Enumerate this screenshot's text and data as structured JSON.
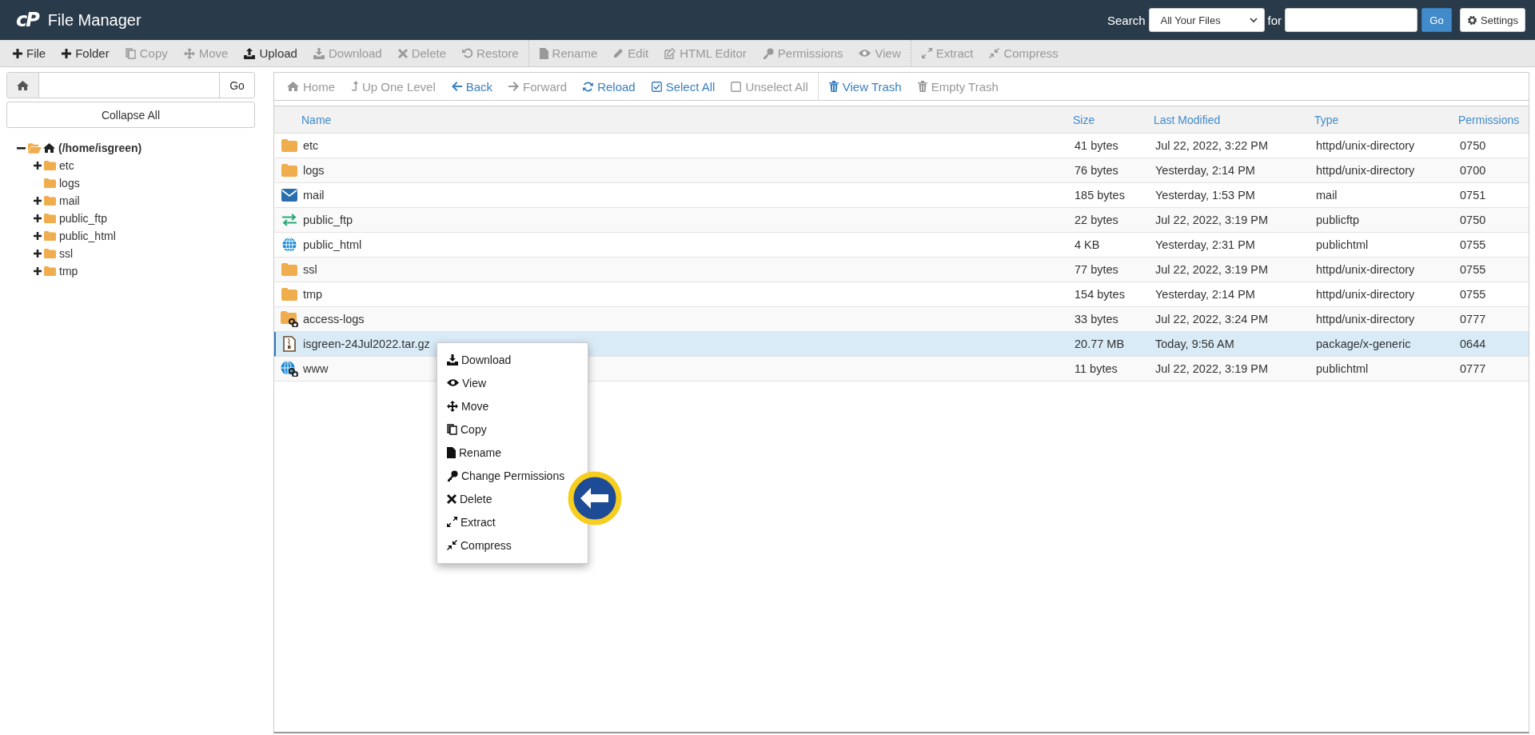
{
  "header": {
    "logo": "cP",
    "title": "File Manager",
    "search_label": "Search",
    "search_scope": "All Your Files",
    "for_label": "for",
    "go_button": "Go",
    "settings_button": "Settings"
  },
  "toolbar": [
    {
      "label": "File",
      "disabled": false
    },
    {
      "label": "Folder",
      "disabled": false
    },
    {
      "label": "Copy",
      "disabled": true
    },
    {
      "label": "Move",
      "disabled": true
    },
    {
      "label": "Upload",
      "disabled": false
    },
    {
      "label": "Download",
      "disabled": true
    },
    {
      "label": "Delete",
      "disabled": true
    },
    {
      "label": "Restore",
      "disabled": true
    },
    {
      "label": "Rename",
      "disabled": true
    },
    {
      "label": "Edit",
      "disabled": true
    },
    {
      "label": "HTML Editor",
      "disabled": true
    },
    {
      "label": "Permissions",
      "disabled": true
    },
    {
      "label": "View",
      "disabled": true
    },
    {
      "label": "Extract",
      "disabled": true
    },
    {
      "label": "Compress",
      "disabled": true
    }
  ],
  "sidebar": {
    "go_button": "Go",
    "collapse_button": "Collapse All",
    "tree": [
      {
        "label": "(/home/isgreen)",
        "expanded": true,
        "toggle": true,
        "children": [
          {
            "label": "etc",
            "expanded": false,
            "toggle": true
          },
          {
            "label": "logs",
            "expanded": false,
            "toggle": false
          },
          {
            "label": "mail",
            "expanded": false,
            "toggle": true
          },
          {
            "label": "public_ftp",
            "expanded": false,
            "toggle": true
          },
          {
            "label": "public_html",
            "expanded": false,
            "toggle": true
          },
          {
            "label": "ssl",
            "expanded": false,
            "toggle": true
          },
          {
            "label": "tmp",
            "expanded": false,
            "toggle": true
          }
        ]
      }
    ]
  },
  "nav": [
    {
      "label": "Home",
      "disabled": true
    },
    {
      "label": "Up One Level",
      "disabled": true
    },
    {
      "label": "Back",
      "disabled": false
    },
    {
      "label": "Forward",
      "disabled": true
    },
    {
      "label": "Reload",
      "disabled": false
    },
    {
      "label": "Select All",
      "disabled": false
    },
    {
      "label": "Unselect All",
      "disabled": true
    },
    {
      "label": "View Trash",
      "disabled": false
    },
    {
      "label": "Empty Trash",
      "disabled": true
    }
  ],
  "table": {
    "columns": [
      "Name",
      "Size",
      "Last Modified",
      "Type",
      "Permissions"
    ],
    "rows": [
      {
        "kind": "folder",
        "name": "etc",
        "size": "41 bytes",
        "modified": "Jul 22, 2022, 3:22 PM",
        "type": "httpd/unix-directory",
        "permissions": "0750",
        "selected": false
      },
      {
        "kind": "folder",
        "name": "logs",
        "size": "76 bytes",
        "modified": "Yesterday, 2:14 PM",
        "type": "httpd/unix-directory",
        "permissions": "0700",
        "selected": false
      },
      {
        "kind": "mail",
        "name": "mail",
        "size": "185 bytes",
        "modified": "Yesterday, 1:53 PM",
        "type": "mail",
        "permissions": "0751",
        "selected": false
      },
      {
        "kind": "ftp",
        "name": "public_ftp",
        "size": "22 bytes",
        "modified": "Jul 22, 2022, 3:19 PM",
        "type": "publicftp",
        "permissions": "0750",
        "selected": false
      },
      {
        "kind": "globe",
        "name": "public_html",
        "size": "4 KB",
        "modified": "Yesterday, 2:31 PM",
        "type": "publichtml",
        "permissions": "0755",
        "selected": false
      },
      {
        "kind": "folder",
        "name": "ssl",
        "size": "77 bytes",
        "modified": "Jul 22, 2022, 3:19 PM",
        "type": "httpd/unix-directory",
        "permissions": "0755",
        "selected": false
      },
      {
        "kind": "folder",
        "name": "tmp",
        "size": "154 bytes",
        "modified": "Yesterday, 2:14 PM",
        "type": "httpd/unix-directory",
        "permissions": "0755",
        "selected": false
      },
      {
        "kind": "folderlink",
        "name": "access-logs",
        "size": "33 bytes",
        "modified": "Jul 22, 2022, 3:24 PM",
        "type": "httpd/unix-directory",
        "permissions": "0777",
        "selected": false
      },
      {
        "kind": "archive",
        "name": "isgreen-24Jul2022.tar.gz",
        "size": "20.77 MB",
        "modified": "Today, 9:56 AM",
        "type": "package/x-generic",
        "permissions": "0644",
        "selected": true
      },
      {
        "kind": "globelink",
        "name": "www",
        "size": "11 bytes",
        "modified": "Jul 22, 2022, 3:19 PM",
        "type": "publichtml",
        "permissions": "0777",
        "selected": false
      }
    ]
  },
  "context_menu": [
    "Download",
    "View",
    "Move",
    "Copy",
    "Rename",
    "Change Permissions",
    "Delete",
    "Extract",
    "Compress"
  ]
}
